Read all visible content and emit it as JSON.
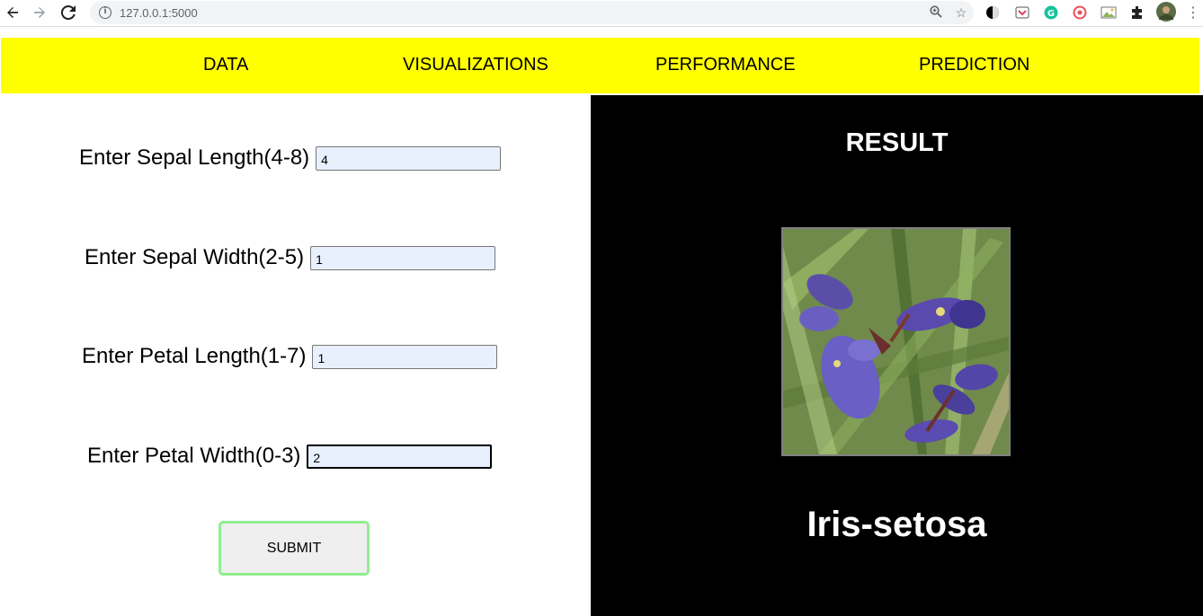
{
  "browser": {
    "url": "127.0.0.1:5000",
    "icons": [
      "back-icon",
      "forward-icon",
      "reload-icon",
      "info-icon",
      "zoom-icon",
      "star-icon",
      "extension-icon",
      "profile-avatar"
    ]
  },
  "navbar": {
    "items": [
      {
        "label": "DATA"
      },
      {
        "label": "VISUALIZATIONS"
      },
      {
        "label": "PERFORMANCE"
      },
      {
        "label": "PREDICTION"
      }
    ],
    "color": "#ffff00"
  },
  "form": {
    "fields": [
      {
        "label": "Enter Sepal Length(4-8)",
        "value": "4"
      },
      {
        "label": "Enter Sepal Width(2-5)",
        "value": "1"
      },
      {
        "label": "Enter Petal Length(1-7)",
        "value": "1"
      },
      {
        "label": "Enter Petal Width(0-3)",
        "value": "2"
      }
    ],
    "submit_label": "SUBMIT",
    "input_bg": "#e8f0fe",
    "submit_border": "#90ee90"
  },
  "result": {
    "title": "RESULT",
    "prediction": "Iris-setosa",
    "image": "iris-flower-image"
  }
}
